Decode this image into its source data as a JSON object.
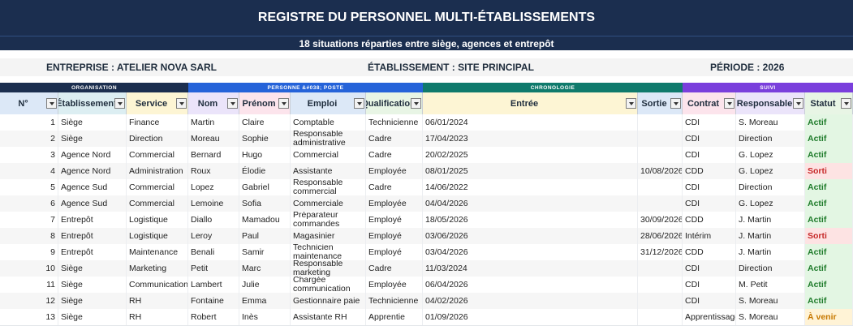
{
  "title": "REGISTRE DU PERSONNEL MULTI-ÉTABLISSEMENTS",
  "subtitle": "18 situations réparties entre siège, agences et entrepôt",
  "info": {
    "entreprise": "ENTREPRISE : ATELIER NOVA SARL",
    "etablissement": "ÉTABLISSEMENT : SITE PRINCIPAL",
    "periode": "PÉRIODE : 2026"
  },
  "groups": {
    "organisation": "ORGANISATION",
    "personne": "PERSONNE &#038; POSTE",
    "chronologie": "CHRONOLOGIE",
    "suivi": "SUIVI"
  },
  "colors": {
    "organisation": "#1b2e4f",
    "personne": "#2563d9",
    "chronologie": "#0f7a6c",
    "suivi": "#7a3fdc"
  },
  "columns": [
    "N°",
    "Établissement",
    "Service",
    "Nom",
    "Prénom",
    "Emploi",
    "Qualification",
    "Entrée",
    "Sortie",
    "Contrat",
    "Responsable",
    "Statut"
  ],
  "rows": [
    {
      "n": "1",
      "etab": "Siège",
      "service": "Finance",
      "nom": "Martin",
      "prenom": "Claire",
      "emploi": "Comptable",
      "qualif": "Technicienne",
      "entree": "06/01/2024",
      "sortie": "",
      "contrat": "CDI",
      "resp": "S. Moreau",
      "statut": "Actif"
    },
    {
      "n": "2",
      "etab": "Siège",
      "service": "Direction",
      "nom": "Moreau",
      "prenom": "Sophie",
      "emploi": "Responsable administrative",
      "qualif": "Cadre",
      "entree": "17/04/2023",
      "sortie": "",
      "contrat": "CDI",
      "resp": "Direction",
      "statut": "Actif"
    },
    {
      "n": "3",
      "etab": "Agence Nord",
      "service": "Commercial",
      "nom": "Bernard",
      "prenom": "Hugo",
      "emploi": "Commercial",
      "qualif": "Cadre",
      "entree": "20/02/2025",
      "sortie": "",
      "contrat": "CDI",
      "resp": "G. Lopez",
      "statut": "Actif"
    },
    {
      "n": "4",
      "etab": "Agence Nord",
      "service": "Administration",
      "nom": "Roux",
      "prenom": "Élodie",
      "emploi": "Assistante",
      "qualif": "Employée",
      "entree": "08/01/2025",
      "sortie": "10/08/2026",
      "contrat": "CDD",
      "resp": "G. Lopez",
      "statut": "Sorti"
    },
    {
      "n": "5",
      "etab": "Agence Sud",
      "service": "Commercial",
      "nom": "Lopez",
      "prenom": "Gabriel",
      "emploi": "Responsable commercial",
      "qualif": "Cadre",
      "entree": "14/06/2022",
      "sortie": "",
      "contrat": "CDI",
      "resp": "Direction",
      "statut": "Actif"
    },
    {
      "n": "6",
      "etab": "Agence Sud",
      "service": "Commercial",
      "nom": "Lemoine",
      "prenom": "Sofia",
      "emploi": "Commerciale",
      "qualif": "Employée",
      "entree": "04/04/2026",
      "sortie": "",
      "contrat": "CDI",
      "resp": "G. Lopez",
      "statut": "Actif"
    },
    {
      "n": "7",
      "etab": "Entrepôt",
      "service": "Logistique",
      "nom": "Diallo",
      "prenom": "Mamadou",
      "emploi": "Préparateur commandes",
      "qualif": "Employé",
      "entree": "18/05/2026",
      "sortie": "30/09/2026",
      "contrat": "CDD",
      "resp": "J. Martin",
      "statut": "Actif"
    },
    {
      "n": "8",
      "etab": "Entrepôt",
      "service": "Logistique",
      "nom": "Leroy",
      "prenom": "Paul",
      "emploi": "Magasinier",
      "qualif": "Employé",
      "entree": "03/06/2026",
      "sortie": "28/06/2026",
      "contrat": "Intérim",
      "resp": "J. Martin",
      "statut": "Sorti"
    },
    {
      "n": "9",
      "etab": "Entrepôt",
      "service": "Maintenance",
      "nom": "Benali",
      "prenom": "Samir",
      "emploi": "Technicien maintenance",
      "qualif": "Employé",
      "entree": "03/04/2026",
      "sortie": "31/12/2026",
      "contrat": "CDD",
      "resp": "J. Martin",
      "statut": "Actif"
    },
    {
      "n": "10",
      "etab": "Siège",
      "service": "Marketing",
      "nom": "Petit",
      "prenom": "Marc",
      "emploi": "Responsable marketing",
      "qualif": "Cadre",
      "entree": "11/03/2024",
      "sortie": "",
      "contrat": "CDI",
      "resp": "Direction",
      "statut": "Actif"
    },
    {
      "n": "11",
      "etab": "Siège",
      "service": "Communication",
      "nom": "Lambert",
      "prenom": "Julie",
      "emploi": "Chargée communication",
      "qualif": "Employée",
      "entree": "06/04/2026",
      "sortie": "",
      "contrat": "CDI",
      "resp": "M. Petit",
      "statut": "Actif"
    },
    {
      "n": "12",
      "etab": "Siège",
      "service": "RH",
      "nom": "Fontaine",
      "prenom": "Emma",
      "emploi": "Gestionnaire paie",
      "qualif": "Technicienne",
      "entree": "04/02/2026",
      "sortie": "",
      "contrat": "CDI",
      "resp": "S. Moreau",
      "statut": "Actif"
    },
    {
      "n": "13",
      "etab": "Siège",
      "service": "RH",
      "nom": "Robert",
      "prenom": "Inès",
      "emploi": "Assistante RH",
      "qualif": "Apprentie",
      "entree": "01/09/2026",
      "sortie": "",
      "contrat": "Apprentissage",
      "resp": "S. Moreau",
      "statut": "À venir"
    }
  ]
}
